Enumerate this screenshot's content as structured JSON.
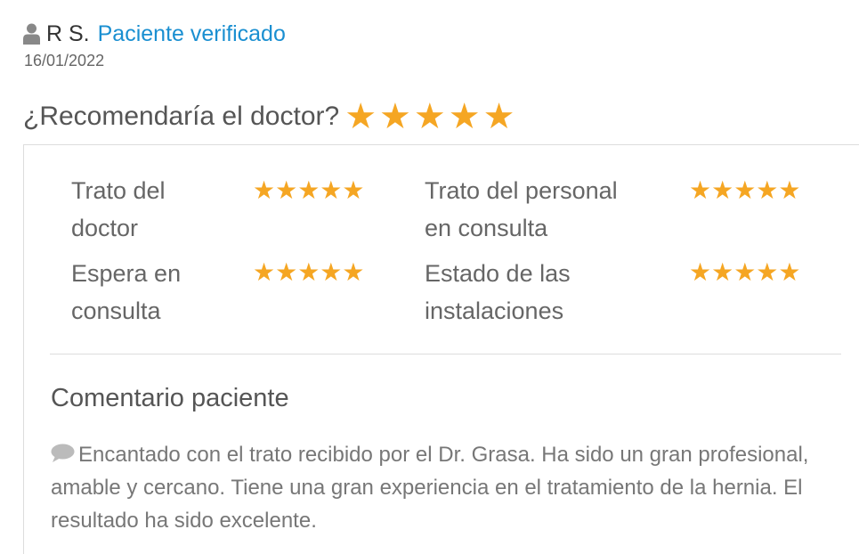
{
  "review": {
    "author": "R S.",
    "verified_label": "Paciente verificado",
    "date": "16/01/2022",
    "recommend_label": "¿Recomendaría el doctor?",
    "recommend_stars": "★★★★★",
    "recommend_rating": 5
  },
  "ratings": [
    {
      "line1": "Trato del",
      "line2": "doctor",
      "stars": "★★★★★",
      "rating": 5
    },
    {
      "line1": "Trato del personal",
      "line2": "en consulta",
      "stars": "★★★★★",
      "rating": 5
    },
    {
      "line1": "Espera en",
      "line2": "consulta",
      "stars": "★★★★★",
      "rating": 5
    },
    {
      "line1": "Estado de las",
      "line2": "instalaciones",
      "stars": "★★★★★",
      "rating": 5
    }
  ],
  "comment": {
    "title": "Comentario paciente",
    "text": "Encantado con el trato recibido por el Dr. Grasa. Ha sido un gran profesional, amable y cercano. Tiene una gran experiencia en el tratamiento de la hernia. El resultado ha sido excelente."
  },
  "colors": {
    "star": "#f5a623",
    "verified": "#1a8fd1",
    "icon": "#888888",
    "comment_icon": "#bbbbbb"
  },
  "icons": {
    "user": "user-icon",
    "comment": "comment-bubble-icon"
  }
}
